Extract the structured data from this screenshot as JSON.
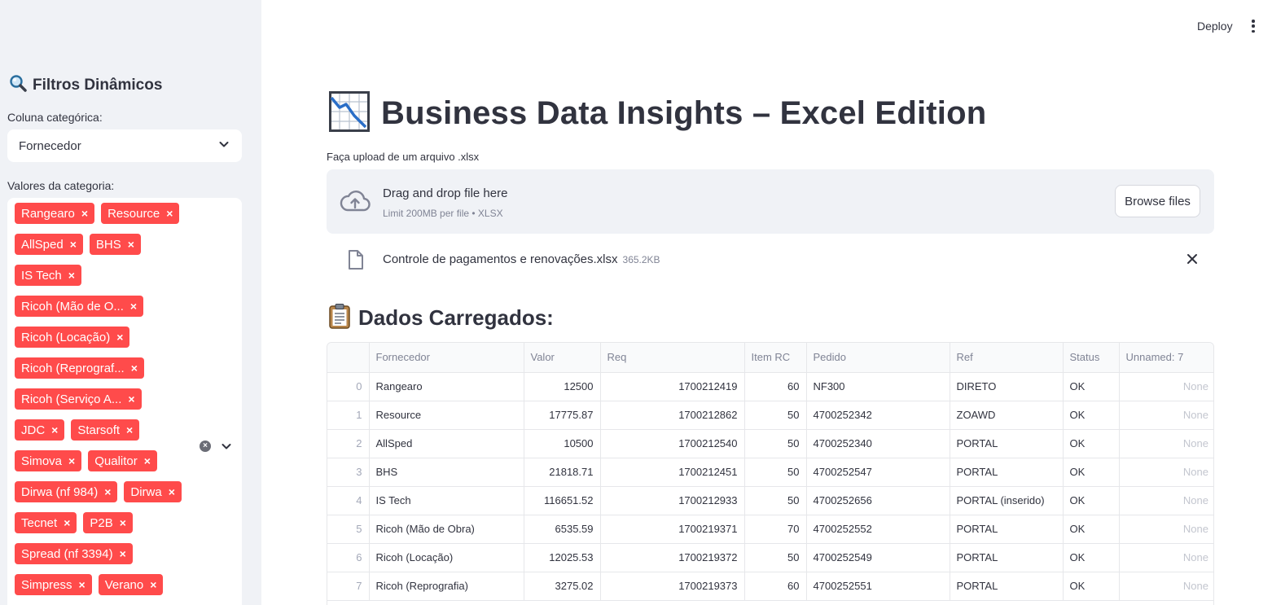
{
  "sidebar": {
    "title": "Filtros Dinâmicos",
    "title_icon": "magnifier-icon",
    "category_column_label": "Coluna categórica:",
    "category_column_value": "Fornecedor",
    "category_values_label": "Valores da categoria:",
    "tag_rows": [
      [
        "Rangearo",
        "Resource"
      ],
      [
        "AllSped",
        "BHS"
      ],
      [
        "IS Tech"
      ],
      [
        "Ricoh (Mão de O..."
      ],
      [
        "Ricoh (Locação)"
      ],
      [
        "Ricoh (Reprograf..."
      ],
      [
        "Ricoh (Serviço A..."
      ],
      [
        "JDC",
        "Starsoft"
      ],
      [
        "Simova",
        "Qualitor"
      ],
      [
        "Dirwa (nf 984)",
        "Dirwa"
      ],
      [
        "Tecnet",
        "P2B"
      ],
      [
        "Spread (nf 3394)"
      ],
      [
        "Simpress",
        "Verano"
      ]
    ],
    "tag_color": "#ff4b4b"
  },
  "header": {
    "deploy_label": "Deploy"
  },
  "main": {
    "title": "Business Data Insights – Excel Edition",
    "title_icon": "chart-decreasing-icon",
    "upload_label": "Faça upload de um arquivo .xlsx",
    "dropzone_text": "Drag and drop file here",
    "dropzone_limit": "Limit 200MB per file • XLSX",
    "browse_label": "Browse files",
    "file_name": "Controle de pagamentos e renovações.xlsx",
    "file_size": "365.2KB",
    "section_title": "Dados Carregados:",
    "section_icon": "clipboard-icon"
  },
  "table": {
    "columns": [
      "",
      "Fornecedor",
      "Valor",
      "Req",
      "Item RC",
      "Pedido",
      "Ref",
      "Status",
      "Unnamed: 7"
    ],
    "rows": [
      [
        "0",
        "Rangearo",
        "12500",
        "1700212419",
        "60",
        "NF300",
        "DIRETO",
        "OK",
        "None"
      ],
      [
        "1",
        "Resource",
        "17775.87",
        "1700212862",
        "50",
        "4700252342",
        "ZOAWD",
        "OK",
        "None"
      ],
      [
        "2",
        "AllSped",
        "10500",
        "1700212540",
        "50",
        "4700252340",
        "PORTAL",
        "OK",
        "None"
      ],
      [
        "3",
        "BHS",
        "21818.71",
        "1700212451",
        "50",
        "4700252547",
        "PORTAL",
        "OK",
        "None"
      ],
      [
        "4",
        "IS Tech",
        "116651.52",
        "1700212933",
        "50",
        "4700252656",
        "PORTAL (inserido)",
        "OK",
        "None"
      ],
      [
        "5",
        "Ricoh (Mão de Obra)",
        "6535.59",
        "1700219371",
        "70",
        "4700252552",
        "PORTAL",
        "OK",
        "None"
      ],
      [
        "6",
        "Ricoh (Locação)",
        "12025.53",
        "1700219372",
        "50",
        "4700252549",
        "PORTAL",
        "OK",
        "None"
      ],
      [
        "7",
        "Ricoh (Reprografia)",
        "3275.02",
        "1700219373",
        "60",
        "4700252551",
        "PORTAL",
        "OK",
        "None"
      ]
    ]
  }
}
